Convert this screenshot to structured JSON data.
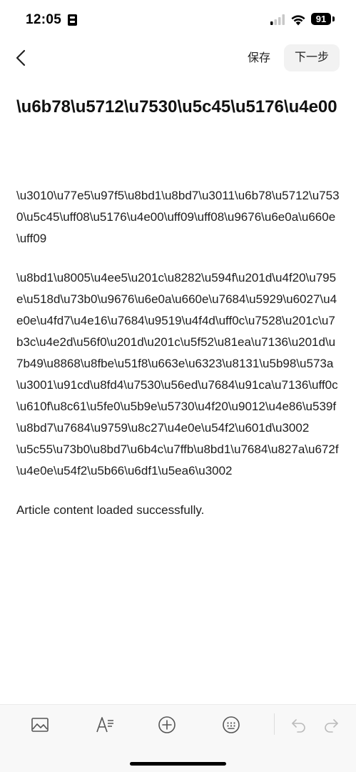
{
  "status_bar": {
    "time": "12:05",
    "battery": "91"
  },
  "nav": {
    "save_label": "保存",
    "next_label": "下一步"
  },
  "article": {
    "title": "\\u6b78\\u5712\\u7530\\u5c45\\u5176\\u4e00",
    "paragraphs": [
      "\\u3010\\u77e5\\u97f5\\u8bd1\\u8bd7\\u3011\\u6b78\\u5712\\u7530\\u5c45\\uff08\\u5176\\u4e00\\uff09\\uff08\\u9676\\u6e0a\\u660e\\uff09",
      "\\u8bd1\\u8005\\u4ee5\\u201c\\u8282\\u594f\\u201d\\u4f20\\u795e\\u518d\\u73b0\\u9676\\u6e0a\\u660e\\u7684\\u5929\\u6027\\u4e0e\\u4fd7\\u4e16\\u7684\\u9519\\u4f4d\\uff0c\\u7528\\u201c\\u7b3c\\u4e2d\\u56f0\\u201d\\u201c\\u5f52\\u81ea\\u7136\\u201d\\u7b49\\u8868\\u8fbe\\u51f8\\u663e\\u6323\\u8131\\u5b98\\u573a\\u3001\\u91cd\\u8fd4\\u7530\\u56ed\\u7684\\u91ca\\u7136\\uff0c\\u610f\\u8c61\\u5fe0\\u5b9e\\u5730\\u4f20\\u9012\\u4e86\\u539f\\u8bd7\\u7684\\u9759\\u8c27\\u4e0e\\u54f2\\u601d\\u3002",
      "\\u5c55\\u73b0\\u8bd7\\u6b4c\\u7ffb\\u8bd1\\u7684\\u827a\\u672f\\u4e0e\\u54f2\\u5b66\\u6df1\\u5ea6\\u3002"
    ],
    "status_message": "Article content loaded successfully."
  },
  "toolbar": {
    "tools": [
      "image-icon",
      "text-format-icon",
      "add-circle-icon",
      "keyboard-icon",
      "undo-icon",
      "redo-icon"
    ]
  }
}
